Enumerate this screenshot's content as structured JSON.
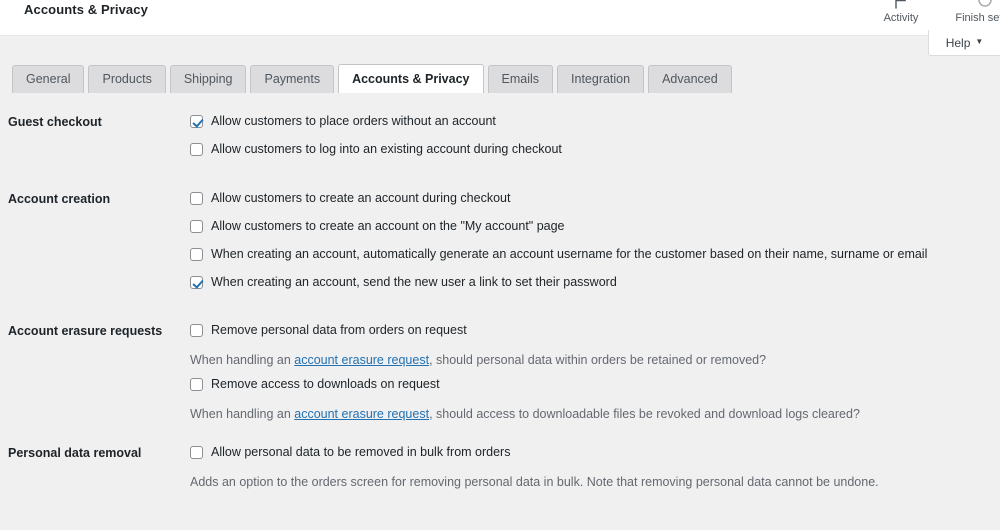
{
  "header": {
    "page_title": "Accounts & Privacy",
    "actions": [
      {
        "label": "Activity",
        "icon": "flag-icon"
      },
      {
        "label": "Finish setup",
        "icon": "progress-circle-icon"
      }
    ],
    "help_tab": {
      "label": "Help",
      "caret": "▼"
    }
  },
  "tabs": [
    {
      "label": "General",
      "active": false
    },
    {
      "label": "Products",
      "active": false
    },
    {
      "label": "Shipping",
      "active": false
    },
    {
      "label": "Payments",
      "active": false
    },
    {
      "label": "Accounts & Privacy",
      "active": true
    },
    {
      "label": "Emails",
      "active": false
    },
    {
      "label": "Integration",
      "active": false
    },
    {
      "label": "Advanced",
      "active": false
    }
  ],
  "sections": {
    "guest_checkout": {
      "label": "Guest checkout",
      "option_1": "Allow customers to place orders without an account",
      "option_1_checked": true,
      "option_2": "Allow customers to log into an existing account during checkout",
      "option_2_checked": false
    },
    "account_creation": {
      "label": "Account creation",
      "option_1": "Allow customers to create an account during checkout",
      "option_1_checked": false,
      "option_2": "Allow customers to create an account on the \"My account\" page",
      "option_2_checked": false,
      "option_3": "When creating an account, automatically generate an account username for the customer based on their name, surname or email",
      "option_3_checked": false,
      "option_4": "When creating an account, send the new user a link to set their password",
      "option_4_checked": true
    },
    "account_erasure": {
      "label": "Account erasure requests",
      "option_1": "Remove personal data from orders on request",
      "option_1_checked": false,
      "desc_1_before": "When handling an ",
      "desc_1_link": "account erasure request",
      "desc_1_after": ", should personal data within orders be retained or removed?",
      "option_2": "Remove access to downloads on request",
      "option_2_checked": false,
      "desc_2_before": "When handling an ",
      "desc_2_link": "account erasure request",
      "desc_2_after": ", should access to downloadable files be revoked and download logs cleared?"
    },
    "personal_data_removal": {
      "label": "Personal data removal",
      "option_1": "Allow personal data to be removed in bulk from orders",
      "option_1_checked": false,
      "desc_1": "Adds an option to the orders screen for removing personal data in bulk. Note that removing personal data cannot be undone."
    }
  },
  "colors": {
    "accent": "#2271b1",
    "link": "#2271b1",
    "page_bg": "#f0f0f1",
    "panel_bg": "#ffffff",
    "tab_bg": "#dcdcde",
    "border": "#c3c4c7",
    "text": "#1d2327",
    "muted_text": "#646970"
  }
}
